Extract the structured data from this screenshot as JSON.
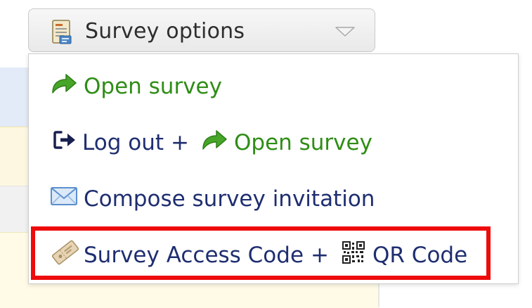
{
  "dropdown": {
    "label": "Survey options",
    "icon": "survey-document-icon",
    "caret_icon": "caret-down-icon"
  },
  "menu": {
    "items": [
      {
        "label": "Open survey",
        "icon": "green-arrow-icon",
        "color": "#2f8d16"
      },
      {
        "label_prefix": "Log out",
        "separator": "+",
        "label_suffix": "Open survey",
        "icons": [
          "logout-icon",
          "green-arrow-icon"
        ]
      },
      {
        "label": "Compose survey invitation",
        "icon": "envelope-icon"
      },
      {
        "label_prefix": "Survey Access Code",
        "separator": "+",
        "label_suffix": "QR Code",
        "icons": [
          "ticket-icon",
          "qr-code-icon"
        ],
        "highlighted": true
      }
    ]
  },
  "colors": {
    "text": "#1f2e70",
    "green": "#2f8d16",
    "highlight": "#ee0b0b"
  }
}
